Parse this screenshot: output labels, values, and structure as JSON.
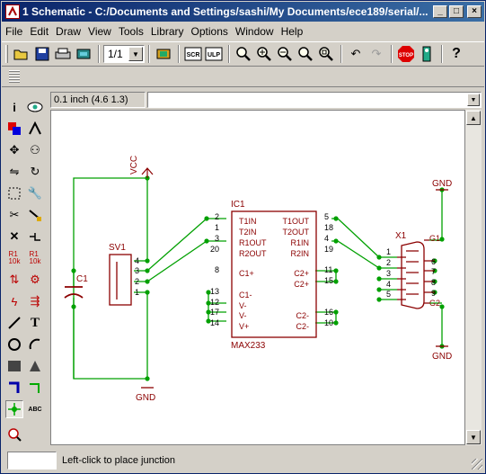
{
  "window": {
    "title": "1 Schematic - C:/Documents and Settings/sashi/My Documents/ece189/serial/...",
    "controls": {
      "minimize": "_",
      "maximize": "□",
      "close": "×"
    }
  },
  "menu": [
    "File",
    "Edit",
    "Draw",
    "View",
    "Tools",
    "Library",
    "Options",
    "Window",
    "Help"
  ],
  "toolbar": {
    "sheet_select": "1/1",
    "buttons": [
      "open-icon",
      "save-icon",
      "print-icon",
      "cam-icon",
      "sheet-icon",
      "board-icon",
      "script-icon",
      "ulp-icon",
      "zoom-fit-icon",
      "zoom-in-icon",
      "zoom-out-icon",
      "zoom-redraw-icon",
      "zoom-area-icon",
      "undo-icon",
      "redo-icon",
      "stop-icon",
      "go-icon",
      "help-icon"
    ],
    "script_label": "SCR",
    "ulp_label": "ULP",
    "stop_label": "STOP"
  },
  "coords": "0.1 inch (4.6 1.3)",
  "status": {
    "message": "Left-click to place junction"
  },
  "schematic": {
    "vcc_label": "VCC",
    "gnd_labels": [
      "GND",
      "GND",
      "GND"
    ],
    "c1": "C1",
    "sv1": "SV1",
    "sv1_pins": [
      "4",
      "3",
      "2",
      "1"
    ],
    "ic1": "IC1",
    "ic1_value": "MAX233",
    "ic1_left_pins": [
      {
        "num": "2",
        "name": "T1IN"
      },
      {
        "num": "1",
        "name": "T2IN"
      },
      {
        "num": "3",
        "name": "R1OUT"
      },
      {
        "num": "20",
        "name": "R2OUT"
      },
      {
        "num": "8",
        "name": "C1+"
      },
      {
        "num": "13",
        "name": "C1-"
      },
      {
        "num": "12",
        "name": "V-"
      },
      {
        "num": "17",
        "name": "V-"
      },
      {
        "num": "14",
        "name": "V+"
      }
    ],
    "ic1_right_pins": [
      {
        "num": "5",
        "name": "T1OUT"
      },
      {
        "num": "18",
        "name": "T2OUT"
      },
      {
        "num": "4",
        "name": "R1IN"
      },
      {
        "num": "19",
        "name": "R2IN"
      },
      {
        "num": "11",
        "name": "C2+"
      },
      {
        "num": "15",
        "name": "C2+"
      },
      {
        "num": "16",
        "name": "C2-"
      },
      {
        "num": "10",
        "name": "C2-"
      }
    ],
    "x1": "X1",
    "x1_pins": [
      "1",
      "2",
      "3",
      "4",
      "5",
      "6",
      "7",
      "8",
      "9"
    ],
    "g1": "G1",
    "g2": "G2"
  },
  "colors": {
    "wire": "#00a000",
    "part": "#8b0000",
    "junction": "#00a000",
    "titlebar": "#0a246a"
  }
}
